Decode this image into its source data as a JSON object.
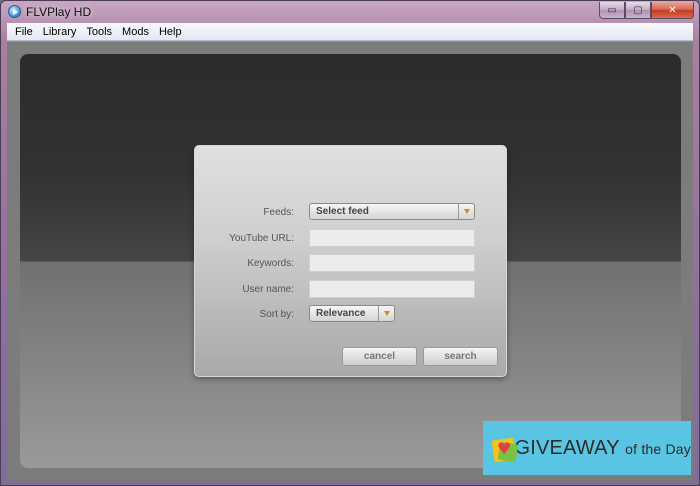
{
  "window": {
    "title": "FLVPlay HD"
  },
  "controls": {
    "minimize": "▭",
    "maximize": "▢",
    "close": "✕"
  },
  "menu": [
    "File",
    "Library",
    "Tools",
    "Mods",
    "Help"
  ],
  "dialog": {
    "feeds_label": "Feeds:",
    "feeds_value": "Select feed",
    "youtube_url_label": "YouTube URL:",
    "youtube_url_value": "",
    "keywords_label": "Keywords:",
    "keywords_value": "",
    "username_label": "User name:",
    "username_value": "",
    "sortby_label": "Sort by:",
    "sortby_value": "Relevance",
    "cancel_label": "cancel",
    "search_label": "search"
  },
  "badge": {
    "main": "GIVEAWAY",
    "suffix": "of the Day"
  },
  "colors": {
    "accent_arrow": "#c7901b",
    "badge_bg": "#5ac5e3"
  }
}
